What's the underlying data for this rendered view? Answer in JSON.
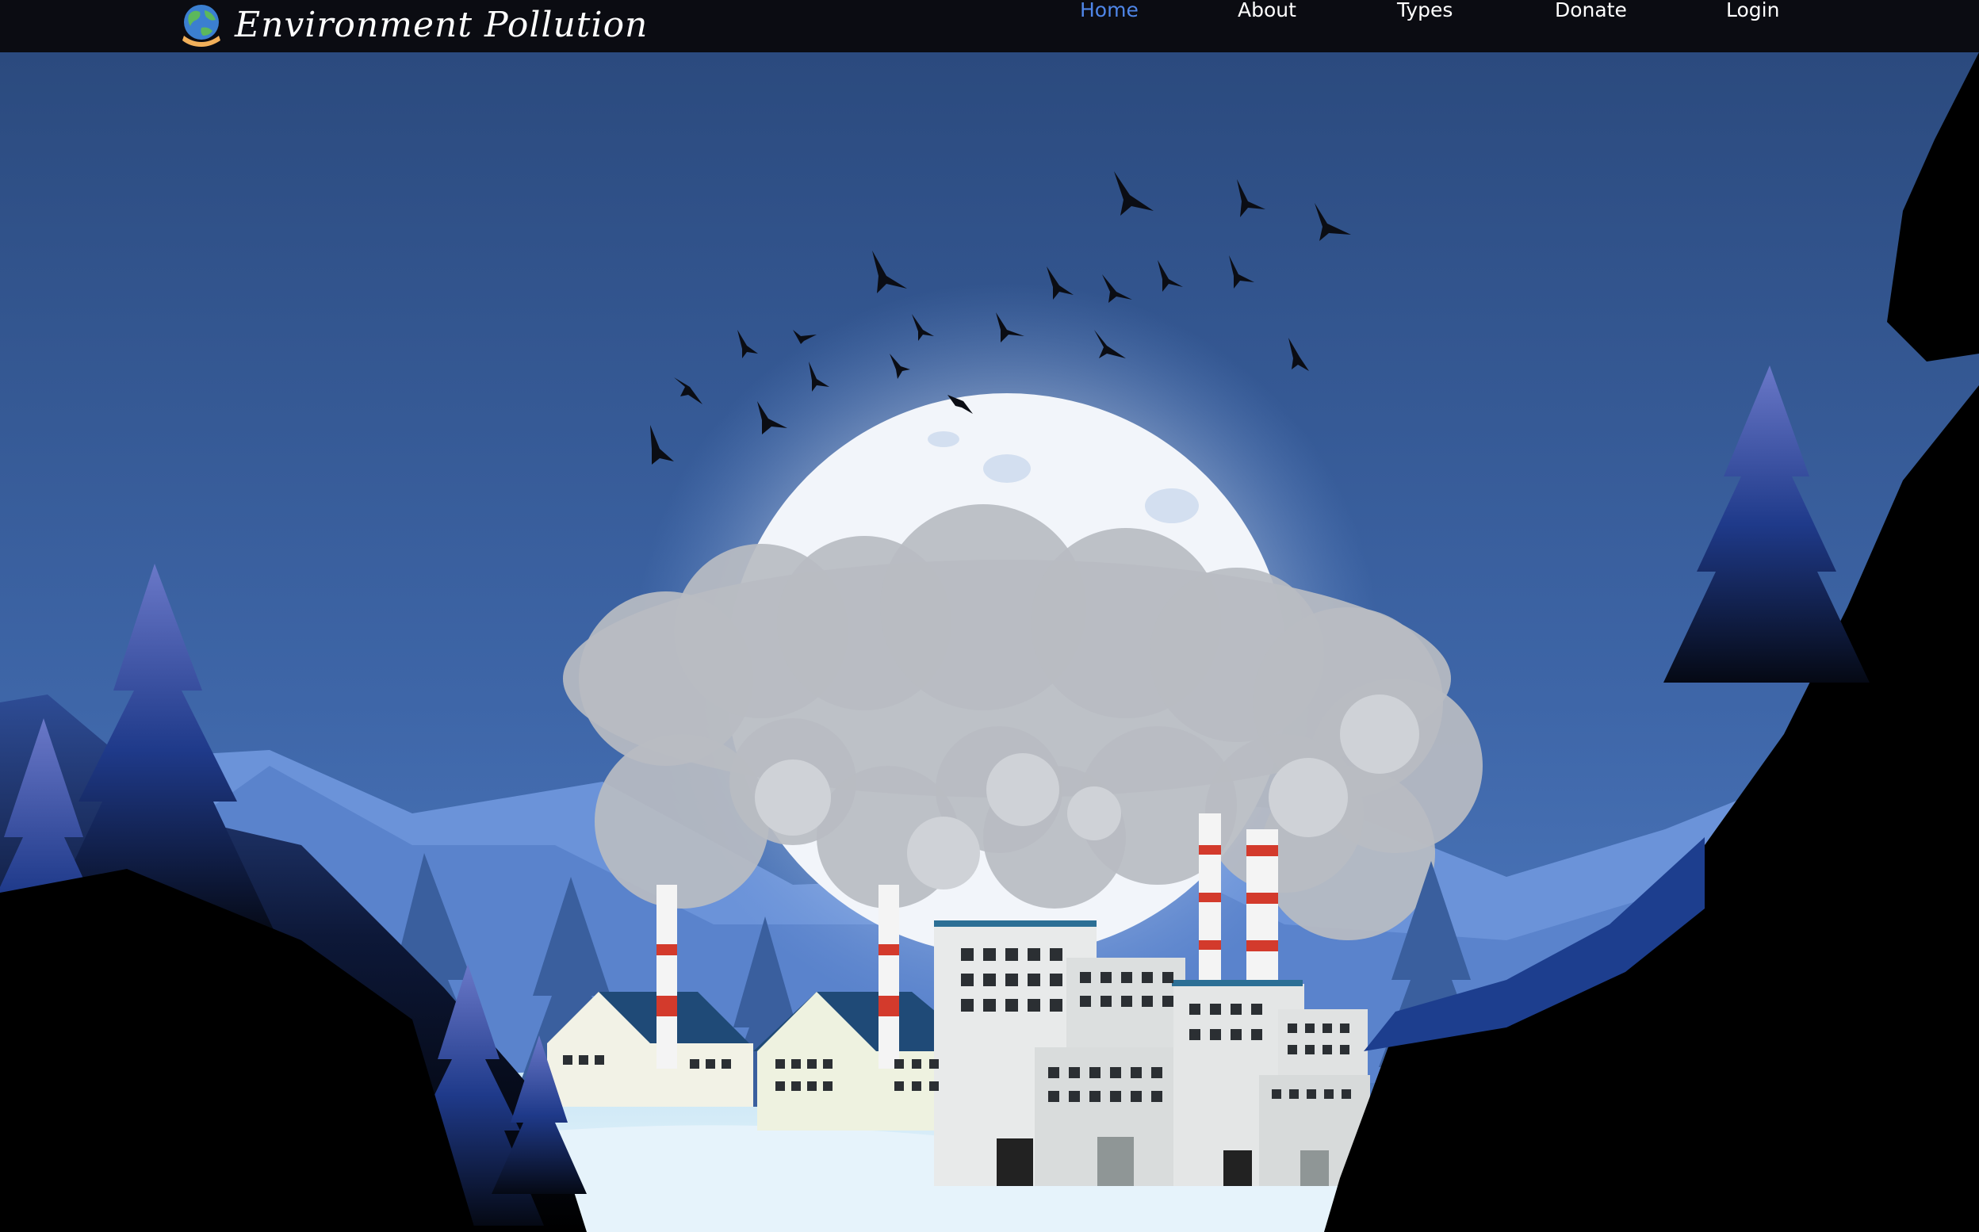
{
  "brand": {
    "name": "Environment Pollution",
    "logo_icon": "earth-in-hand-icon"
  },
  "nav": {
    "items": [
      {
        "label": "Home",
        "active": true
      },
      {
        "label": "About",
        "active": false
      },
      {
        "label": "Types",
        "active": false
      },
      {
        "label": "Donate",
        "active": false
      },
      {
        "label": "Login",
        "active": false
      }
    ]
  },
  "colors": {
    "navbar_bg": "#0b0c12",
    "active_link": "#4f86e8",
    "sky_top": "#2b4a7e",
    "sky_bottom": "#4d7cc4"
  }
}
